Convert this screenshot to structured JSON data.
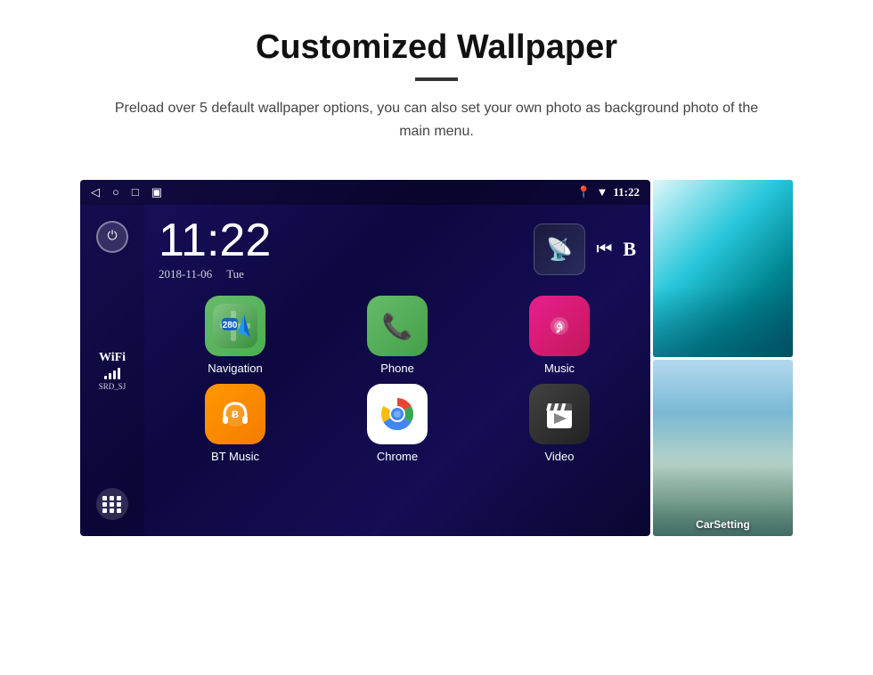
{
  "header": {
    "title": "Customized Wallpaper",
    "subtitle": "Preload over 5 default wallpaper options, you can also set your own photo as background photo of the main menu."
  },
  "statusBar": {
    "time": "11:22",
    "icons": [
      "◁",
      "○",
      "□",
      "▣"
    ]
  },
  "clock": {
    "time": "11:22",
    "date": "2018-11-06",
    "day": "Tue"
  },
  "wifi": {
    "label": "WiFi",
    "ssid": "SRD_SJ"
  },
  "apps": [
    {
      "name": "Navigation",
      "id": "navigation"
    },
    {
      "name": "Phone",
      "id": "phone"
    },
    {
      "name": "Music",
      "id": "music"
    },
    {
      "name": "BT Music",
      "id": "bt-music"
    },
    {
      "name": "Chrome",
      "id": "chrome"
    },
    {
      "name": "Video",
      "id": "video"
    }
  ],
  "wallpapers": [
    {
      "name": "glacier",
      "label": ""
    },
    {
      "name": "bridge",
      "label": "CarSetting"
    }
  ]
}
